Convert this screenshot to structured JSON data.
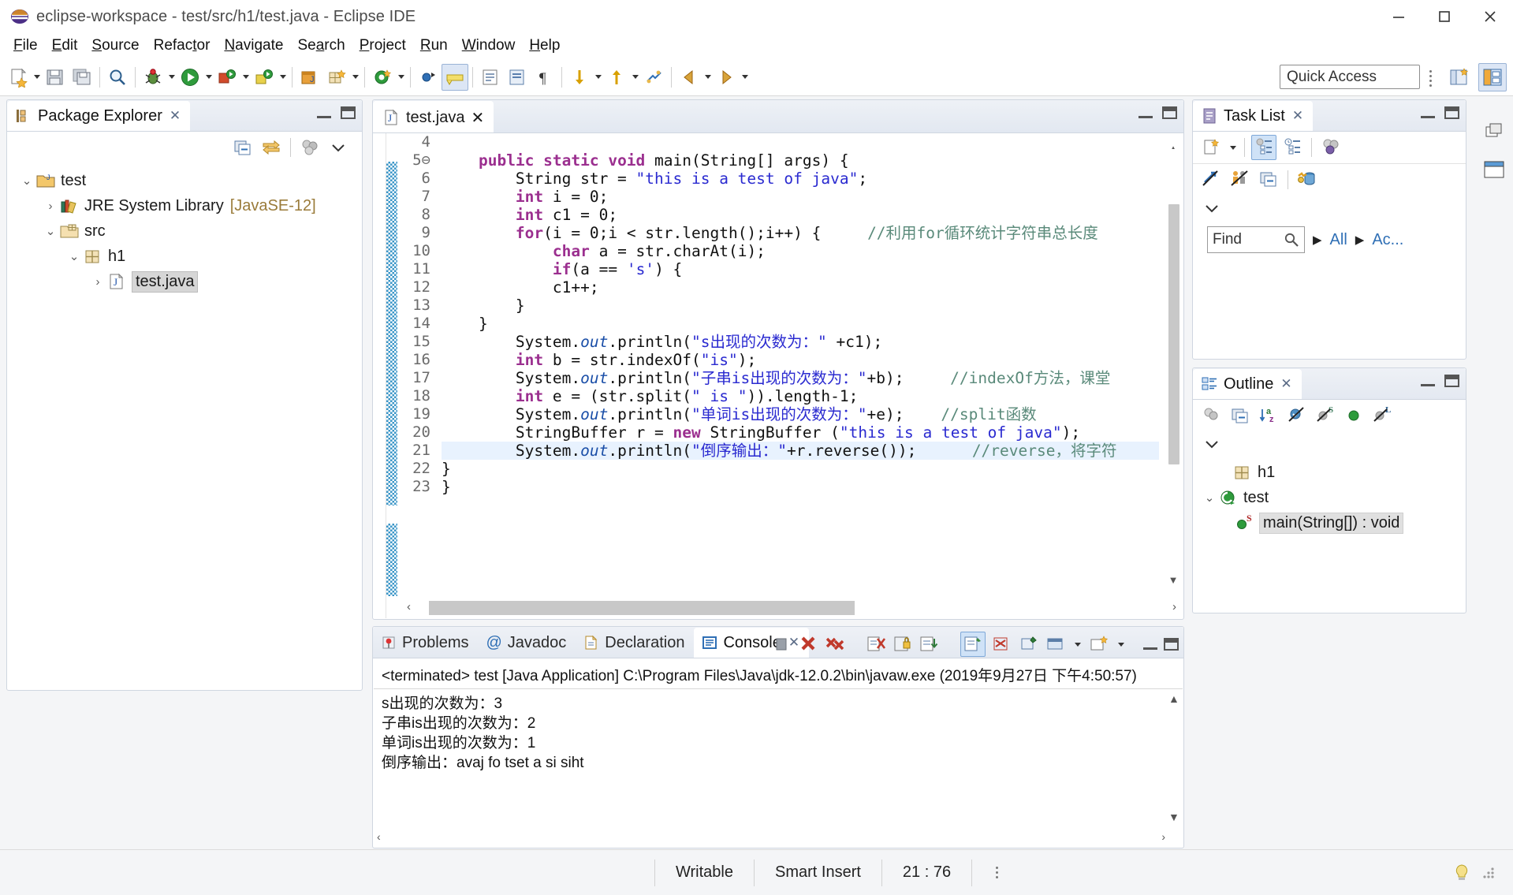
{
  "window": {
    "title": "eclipse-workspace - test/src/h1/test.java - Eclipse IDE",
    "minimize": "─",
    "maximize": "☐",
    "close": "✕"
  },
  "menubar": {
    "items": [
      "File",
      "Edit",
      "Source",
      "Refactor",
      "Navigate",
      "Search",
      "Project",
      "Run",
      "Window",
      "Help"
    ]
  },
  "toolbar": {
    "quick_access_placeholder": "Quick Access",
    "quick_access_value": "Quick Access"
  },
  "package_explorer": {
    "title": "Package Explorer",
    "close_label": "✕",
    "tree": [
      {
        "label": "test",
        "arrow": "⌄",
        "icon": "java-project-icon",
        "indent": 0,
        "suffix": ""
      },
      {
        "label": "JRE System Library",
        "arrow": "›",
        "icon": "library-icon",
        "indent": 1,
        "suffix": "[JavaSE-12]"
      },
      {
        "label": "src",
        "arrow": "⌄",
        "icon": "source-folder-icon",
        "indent": 1,
        "suffix": ""
      },
      {
        "label": "h1",
        "arrow": "⌄",
        "icon": "package-icon",
        "indent": 2,
        "suffix": ""
      },
      {
        "label": "test.java",
        "arrow": "›",
        "icon": "java-file-icon",
        "indent": 3,
        "suffix": ""
      }
    ]
  },
  "editor": {
    "tab_label": "test.java",
    "tab_close": "✕",
    "first_line_number": 4,
    "lines": [
      {
        "n": 4,
        "fold": "",
        "highlight": false,
        "tokens": []
      },
      {
        "n": 5,
        "fold": "⊖",
        "highlight": false,
        "tokens": [
          {
            "t": "    ",
            "c": ""
          },
          {
            "t": "public static void ",
            "c": "kw"
          },
          {
            "t": "main(String[] args) {",
            "c": ""
          }
        ]
      },
      {
        "n": 6,
        "fold": "",
        "highlight": false,
        "tokens": [
          {
            "t": "        String str = ",
            "c": ""
          },
          {
            "t": "\"this is a test of java\"",
            "c": "str"
          },
          {
            "t": ";",
            "c": ""
          }
        ]
      },
      {
        "n": 7,
        "fold": "",
        "highlight": false,
        "tokens": [
          {
            "t": "        ",
            "c": ""
          },
          {
            "t": "int",
            "c": "kw"
          },
          {
            "t": " i = 0;",
            "c": ""
          }
        ]
      },
      {
        "n": 8,
        "fold": "",
        "highlight": false,
        "tokens": [
          {
            "t": "        ",
            "c": ""
          },
          {
            "t": "int",
            "c": "kw"
          },
          {
            "t": " c1 = 0;",
            "c": ""
          }
        ]
      },
      {
        "n": 9,
        "fold": "",
        "highlight": false,
        "tokens": [
          {
            "t": "        ",
            "c": ""
          },
          {
            "t": "for",
            "c": "kw"
          },
          {
            "t": "(i = 0;i < str.length();i++) {     ",
            "c": ""
          },
          {
            "t": "//利用for循环统计字符串总长度",
            "c": "cmt"
          }
        ]
      },
      {
        "n": 10,
        "fold": "",
        "highlight": false,
        "tokens": [
          {
            "t": "            ",
            "c": ""
          },
          {
            "t": "char",
            "c": "kw"
          },
          {
            "t": " a = str.charAt(i);",
            "c": ""
          }
        ]
      },
      {
        "n": 11,
        "fold": "",
        "highlight": false,
        "tokens": [
          {
            "t": "            ",
            "c": ""
          },
          {
            "t": "if",
            "c": "kw"
          },
          {
            "t": "(a == ",
            "c": ""
          },
          {
            "t": "'s'",
            "c": "str"
          },
          {
            "t": ") {",
            "c": ""
          }
        ]
      },
      {
        "n": 12,
        "fold": "",
        "highlight": false,
        "tokens": [
          {
            "t": "            c1++;",
            "c": ""
          }
        ]
      },
      {
        "n": 13,
        "fold": "",
        "highlight": false,
        "tokens": [
          {
            "t": "        }",
            "c": ""
          }
        ]
      },
      {
        "n": 14,
        "fold": "",
        "highlight": false,
        "tokens": [
          {
            "t": "    }",
            "c": ""
          }
        ]
      },
      {
        "n": 15,
        "fold": "",
        "highlight": false,
        "tokens": [
          {
            "t": "        System.",
            "c": ""
          },
          {
            "t": "out",
            "c": "fld"
          },
          {
            "t": ".println(",
            "c": ""
          },
          {
            "t": "\"s出现的次数为：\"",
            "c": "str"
          },
          {
            "t": " +c1);",
            "c": ""
          }
        ]
      },
      {
        "n": 16,
        "fold": "",
        "highlight": false,
        "tokens": [
          {
            "t": "        ",
            "c": ""
          },
          {
            "t": "int",
            "c": "kw"
          },
          {
            "t": " b = str.indexOf(",
            "c": ""
          },
          {
            "t": "\"is\"",
            "c": "str"
          },
          {
            "t": ");",
            "c": ""
          }
        ]
      },
      {
        "n": 17,
        "fold": "",
        "highlight": false,
        "tokens": [
          {
            "t": "        System.",
            "c": ""
          },
          {
            "t": "out",
            "c": "fld"
          },
          {
            "t": ".println(",
            "c": ""
          },
          {
            "t": "\"子串is出现的次数为：\"",
            "c": "str"
          },
          {
            "t": "+b);     ",
            "c": ""
          },
          {
            "t": "//indexOf方法，课堂",
            "c": "cmt"
          }
        ]
      },
      {
        "n": 18,
        "fold": "",
        "highlight": false,
        "tokens": [
          {
            "t": "        ",
            "c": ""
          },
          {
            "t": "int",
            "c": "kw"
          },
          {
            "t": " e = (str.split(",
            "c": ""
          },
          {
            "t": "\" is \"",
            "c": "str"
          },
          {
            "t": ")).length-1;",
            "c": ""
          }
        ]
      },
      {
        "n": 19,
        "fold": "",
        "highlight": false,
        "tokens": [
          {
            "t": "        System.",
            "c": ""
          },
          {
            "t": "out",
            "c": "fld"
          },
          {
            "t": ".println(",
            "c": ""
          },
          {
            "t": "\"单词is出现的次数为：\"",
            "c": "str"
          },
          {
            "t": "+e);    ",
            "c": ""
          },
          {
            "t": "//split函数",
            "c": "cmt"
          }
        ]
      },
      {
        "n": 20,
        "fold": "",
        "highlight": false,
        "tokens": [
          {
            "t": "        StringBuffer r = ",
            "c": ""
          },
          {
            "t": "new",
            "c": "kw"
          },
          {
            "t": " StringBuffer (",
            "c": ""
          },
          {
            "t": "\"this is a test of java\"",
            "c": "str"
          },
          {
            "t": ");",
            "c": ""
          }
        ]
      },
      {
        "n": 21,
        "fold": "",
        "highlight": true,
        "tokens": [
          {
            "t": "        System.",
            "c": ""
          },
          {
            "t": "out",
            "c": "fld"
          },
          {
            "t": ".println(",
            "c": ""
          },
          {
            "t": "\"倒序输出：\"",
            "c": "str"
          },
          {
            "t": "+r.reverse());      ",
            "c": ""
          },
          {
            "t": "//reverse，将字符",
            "c": "cmt"
          }
        ]
      },
      {
        "n": 22,
        "fold": "",
        "highlight": false,
        "tokens": [
          {
            "t": "}",
            "c": ""
          }
        ]
      },
      {
        "n": 23,
        "fold": "",
        "highlight": false,
        "tokens": [
          {
            "t": "}",
            "c": ""
          }
        ]
      }
    ]
  },
  "bottom_panel": {
    "tabs": [
      {
        "label": "Problems",
        "icon": "problems-icon",
        "active": false
      },
      {
        "label": "Javadoc",
        "icon": "javadoc-icon",
        "active": false
      },
      {
        "label": "Declaration",
        "icon": "declaration-icon",
        "active": false
      },
      {
        "label": "Console",
        "icon": "console-icon",
        "active": true
      }
    ],
    "close_label": "✕",
    "console": {
      "header": "<terminated> test [Java Application] C:\\Program Files\\Java\\jdk-12.0.2\\bin\\javaw.exe (2019年9月27日 下午4:50:57)",
      "output": [
        "s出现的次数为：3",
        "子串is出现的次数为：2",
        "单词is出现的次数为：1",
        "倒序输出：avaj fo tset a si siht"
      ]
    }
  },
  "task_list": {
    "title": "Task List",
    "close_label": "✕",
    "find_placeholder": "Find",
    "find_value": "Find",
    "filters": [
      "All",
      "Ac..."
    ]
  },
  "outline": {
    "title": "Outline",
    "close_label": "✕",
    "tree": [
      {
        "label": "h1",
        "icon": "package-icon",
        "arrow": "",
        "indent": 1,
        "selected": false
      },
      {
        "label": "test",
        "icon": "class-icon",
        "arrow": "⌄",
        "indent": 1,
        "selected": false
      },
      {
        "label": "main(String[]) : void",
        "icon": "method-static-icon",
        "arrow": "",
        "indent": 2,
        "selected": true
      }
    ]
  },
  "statusbar": {
    "writable": "Writable",
    "insert_mode": "Smart Insert",
    "position": "21 : 76"
  }
}
